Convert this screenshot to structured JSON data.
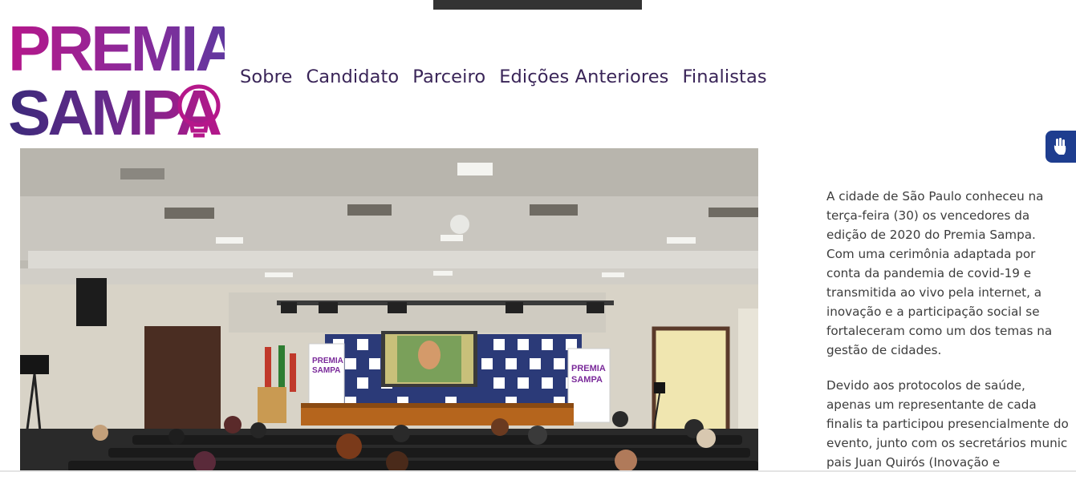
{
  "logo": {
    "line1": "PREMIA",
    "line2": "SAMPA",
    "colors": {
      "magenta": "#b5178a",
      "purple": "#6a3a9c",
      "indigo": "#3b2a7a"
    }
  },
  "nav": {
    "items": [
      "Sobre",
      "Candidato",
      "Parceiro",
      "Edições Anteriores",
      "Finalistas"
    ]
  },
  "accessibility": {
    "icon": "sign-language-icon"
  },
  "photo": {
    "banner_left": {
      "line1": "PREMIA",
      "line2": "SAMPA"
    },
    "banner_right": {
      "line1": "PREMIA",
      "line2": "SAMPA"
    }
  },
  "article": {
    "paragraphs": [
      "A cidade de São Paulo conheceu na\nterça-feira (30) os vencedores da\nedição de 2020 do Premia Sampa.\nCom uma cerimônia adaptada por\nconta da pandemia de covid-19 e\ntransmitida ao vivo pela internet, a\ninovação e a participação social se\nfortaleceram como um dos temas na\ngestão de cidades.",
      "Devido aos protocolos de saúde,\napenas um representante de cada\nfinalis ta participou presencialmente do\nevento, junto com os secretários munic\npais Juan Quirós (Inovação e"
    ]
  }
}
